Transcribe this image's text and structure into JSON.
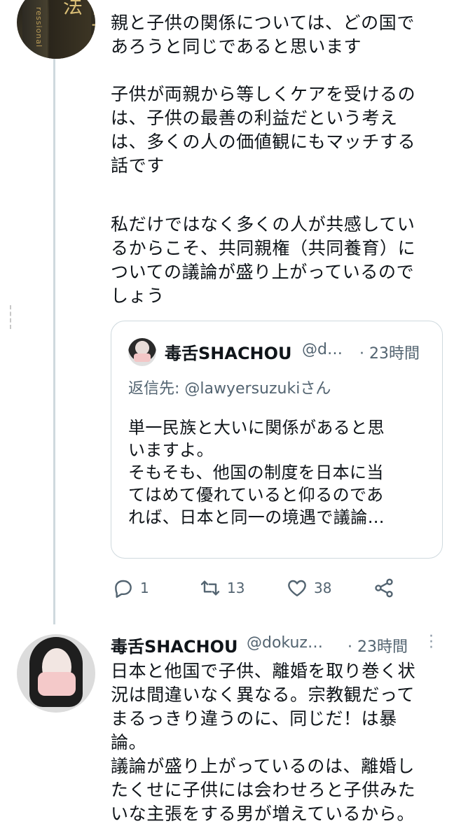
{
  "tweet1": {
    "avatar_text_small": "ressional",
    "avatar_text_large": "例六法",
    "paragraphs": [
      "親と子供の関係については、どの国で\nあろうと同じであると思います",
      "子供が両親から等しくケアを受けるの\nは、子供の最善の利益だという考え\nは、多くの人の価値観にもマッチする\n話です",
      "私だけではなく多くの人が共感してい\nるからこそ、共同親権（共同養育）に\nついての議論が盛り上がっているので\nしょう"
    ]
  },
  "quote": {
    "name": "毒舌SHACHOU",
    "handle": "@d…",
    "time": "· 23時間",
    "reply_label": "返信先: ",
    "reply_mention": "@lawyersuzuki",
    "reply_suffix": "さん",
    "body": "単一民族と大いに関係があると思\nいますよ。\nそもそも、他国の制度を日本に当\nてはめて優れていると仰るのであ\nれば、日本と同一の境遇で議論…"
  },
  "actions": {
    "reply_count": "1",
    "retweet_count": "13",
    "like_count": "38"
  },
  "tweet2": {
    "name": "毒舌SHACHOU",
    "handle": "@dokuz…",
    "time": "· 23時間",
    "body": "日本と他国で子供、離婚を取り巻く状\n況は間違いなく異なる。宗教観だって\nまるっきり違うのに、同じだ！は暴\n論。\n議論が盛り上がっているのは、離婚し\nたくせに子供には会わせろと子供みた\nいな主張をする男が増えているから。"
  },
  "colors": {
    "text": "#0f1419",
    "secondary": "#536471",
    "border": "#cfd9de"
  }
}
